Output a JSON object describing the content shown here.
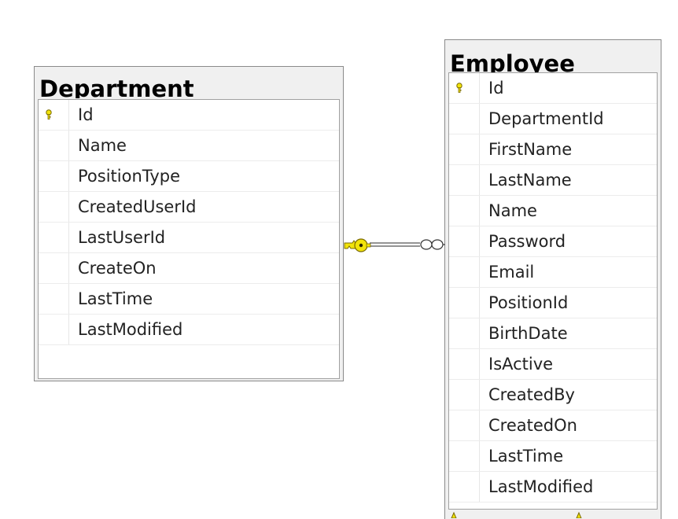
{
  "tables": {
    "department": {
      "title": "Department",
      "columns": [
        "Id",
        "Name",
        "PositionType",
        "CreatedUserId",
        "LastUserId",
        "CreateOn",
        "LastTime",
        "LastModified"
      ],
      "primary_key": "Id"
    },
    "employee": {
      "title": "Employee",
      "columns": [
        "Id",
        "DepartmentId",
        "FirstName",
        "LastName",
        "Name",
        "Password",
        "Email",
        "PositionId",
        "BirthDate",
        "IsActive",
        "CreatedBy",
        "CreatedOn",
        "LastTime",
        "LastModified"
      ],
      "primary_key": "Id"
    }
  },
  "relationship": {
    "from": "Department",
    "to": "Employee",
    "from_end": "key-icon",
    "to_end": "infinity-icon"
  },
  "colors": {
    "key": "#f2e40a",
    "key_outline": "#7a6a00",
    "border": "#8a8a8a",
    "header_bg": "#f0f0f0"
  }
}
